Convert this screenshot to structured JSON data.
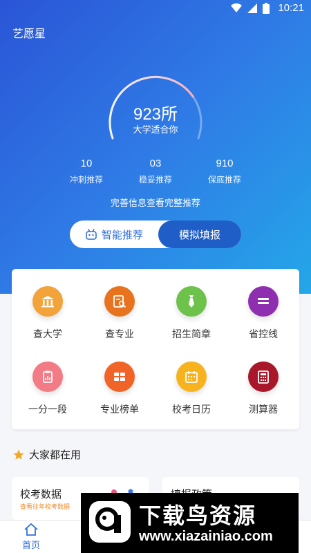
{
  "status_bar": {
    "time": "10:21"
  },
  "app": {
    "title": "艺愿星"
  },
  "gauge": {
    "count": "923所",
    "subtitle": "大学适合你",
    "fill_fraction": 0.75
  },
  "stats": [
    {
      "value": "10",
      "label": "冲刺推荐"
    },
    {
      "value": "03",
      "label": "稳妥推荐"
    },
    {
      "value": "910",
      "label": "保底推荐"
    }
  ],
  "complete_info_link": "完善信息查看完整推荐",
  "toggle": {
    "left_label": "智能推荐",
    "right_label": "模拟填报",
    "active": "right"
  },
  "grid": [
    {
      "label": "查大学",
      "icon": "university-icon",
      "color": "#f2a33a"
    },
    {
      "label": "查专业",
      "icon": "major-search-icon",
      "color": "#e8731f"
    },
    {
      "label": "招生简章",
      "icon": "tie-icon",
      "color": "#6cc24a"
    },
    {
      "label": "省控线",
      "icon": "list-icon",
      "color": "#8e2fb0"
    },
    {
      "label": "一分一段",
      "icon": "clipboard-icon",
      "color": "#f27b86"
    },
    {
      "label": "专业榜单",
      "icon": "ranking-icon",
      "color": "#f06428"
    },
    {
      "label": "校考日历",
      "icon": "calendar-icon",
      "color": "#f7b31e"
    },
    {
      "label": "测算器",
      "icon": "calculator-icon",
      "color": "#a8182a"
    }
  ],
  "section": {
    "title": "大家都在用"
  },
  "features": [
    {
      "title": "校考数据",
      "subtitle": "查看往年校考数据"
    },
    {
      "title": "填报政策",
      "subtitle": ""
    }
  ],
  "watermark": {
    "text": "下载鸟资源",
    "url": "www.xiazainiao.com"
  },
  "bottom_nav": [
    {
      "label": "首页",
      "active": true
    }
  ]
}
